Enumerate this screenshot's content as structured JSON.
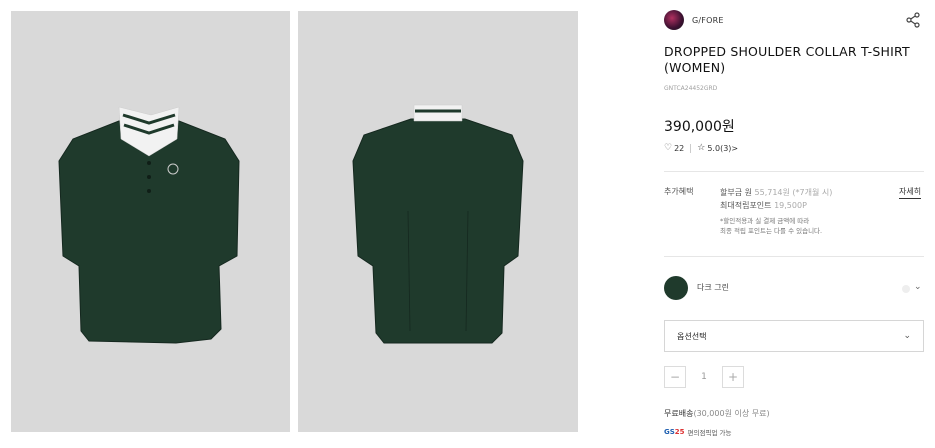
{
  "brand": {
    "name": "G/FORE"
  },
  "product": {
    "title": "DROPPED SHOULDER COLLAR T-SHIRT (WOMEN)",
    "code": "GNTCA24452GRD",
    "price": "390,000원",
    "likes": "22",
    "rating": "5.0",
    "reviews": "(3)",
    "rating_chevron": ">"
  },
  "benefits": {
    "label": "추가혜택",
    "installment_prefix": "할부금 원",
    "installment_value": "55,714원 (*7개월 시)",
    "points_label": "최대적립포인트",
    "points_value": "19,500P",
    "note_line1": "*할인적용과 실 결제 금액에 따라",
    "note_line2": "최종 적립 포인트는 다를 수 있습니다.",
    "detail_link": "자세히"
  },
  "color": {
    "name": "다크 그린",
    "swatch": "#1f3a2c"
  },
  "option": {
    "label": "옵션선택",
    "chevron": "⌄"
  },
  "quantity": {
    "minus": "−",
    "value": "1",
    "plus": "+"
  },
  "shipping": {
    "label": "무료배송",
    "threshold": "(30,000원 이상 무료)",
    "gs_text": "편의점픽업 가능"
  },
  "icons": {
    "share": "share-icon",
    "heart": "heart-icon",
    "star": "star-icon"
  },
  "colors": {
    "shirt": "#1f3a2c",
    "gallery_bg": "#d9d9d9"
  }
}
